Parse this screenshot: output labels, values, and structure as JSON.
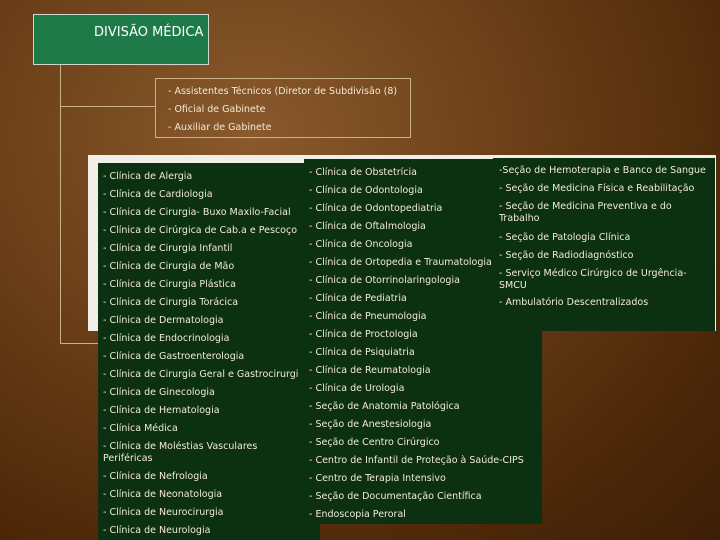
{
  "title": "DIVISÃO MÉDICA",
  "staff": [
    "- Assistentes Técnicos (Diretor de  Subdivisão (8)",
    "- Oficial de Gabinete",
    "- Auxiliar de Gabinete"
  ],
  "column1": [
    "- Clínica de Alergia",
    "- Clínica de Cardiologia",
    "- Clínica de Cirurgia- Buxo Maxilo-Facial",
    "- Clínica de Cirúrgica de Cab.a e Pescoço",
    "- Clínica de Cirurgia Infantil",
    "- Clínica de Cirurgia de Mão",
    "- Clínica de Cirurgia Plástica",
    "- Clínica de Cirurgia Torácica",
    "- Clínica de Dermatologia",
    "- Clínica de Endocrinologia",
    "- Clínica de Gastroenterologia",
    "- Clínica de Cirurgia Geral e Gastrocirurgi",
    "- Clínica de Ginecologia",
    "- Clínica de Hematologia",
    "- Clínica Médica",
    "- Clínica de Moléstias Vasculares Periféricas",
    "- Clínica de Nefrologia",
    "- Clínica de Neonatologia",
    "- Clínica de Neurocirurgia",
    "- Clínica de Neurologia"
  ],
  "column2": [
    "- Clínica de Obstetrícia",
    "- Clínica de Odontologia",
    "- Clínica de Odontopediatria",
    "- Clínica de Oftalmologia",
    "- Clínica de Oncologia",
    "- Clínica de Ortopedia e Traumatologia",
    "- Clínica de Otorrinolaringologia",
    "- Clínica de Pediatria",
    "- Clínica de Pneumologia",
    "- Clínica de Proctologia",
    "- Clínica de Psiquiatria",
    "- Clínica de Reumatologia",
    "- Clínica de Urologia",
    "- Seção de Anatomia Patológica",
    "- Seção de Anestesiologia",
    "- Seção de Centro Cirúrgico",
    "- Centro de Infantil de Proteção à Saúde-CIPS",
    "- Centro de Terapia Intensivo",
    "- Seção de Documentação Científica",
    "- Endoscopia Peroral"
  ],
  "column3": [
    "-Seção de Hemoterapia e Banco de Sangue",
    "- Seção de Medicina Física e Reabilitação",
    "- Seção de Medicina Preventiva e do Trabalho",
    "- Seção de Patologia Clínica",
    "- Seção de Radiodiagnóstico",
    "- Serviço Médico Cirúrgico de Urgência- SMCU",
    "- Ambulatório Descentralizados"
  ]
}
